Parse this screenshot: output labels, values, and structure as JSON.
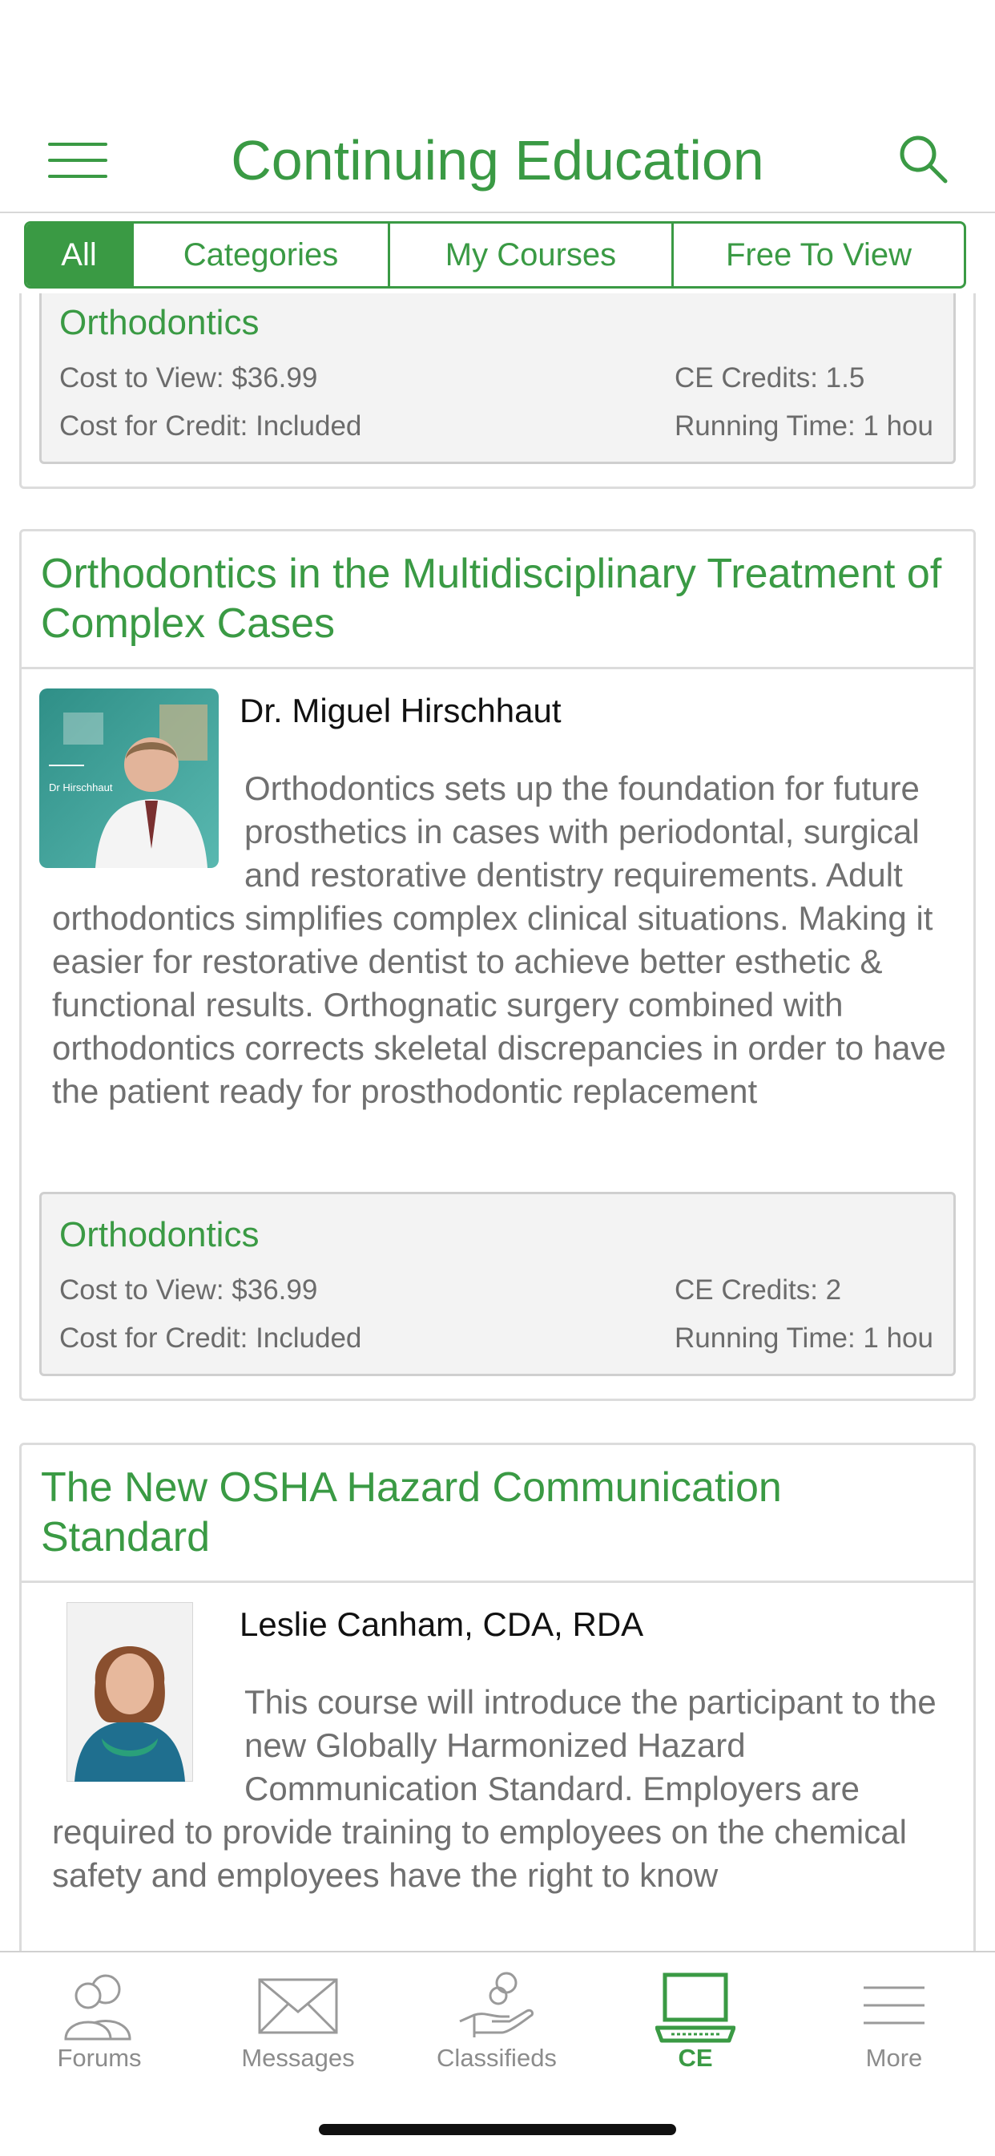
{
  "header": {
    "title": "Continuing Education"
  },
  "tabs": [
    {
      "label": "All",
      "active": true
    },
    {
      "label": "Categories",
      "active": false
    },
    {
      "label": "My Courses",
      "active": false
    },
    {
      "label": "Free To View",
      "active": false
    }
  ],
  "courses": [
    {
      "info": {
        "category": "Orthodontics",
        "cost_to_view": "Cost to View: $36.99",
        "cost_for_credit": "Cost for Credit: Included",
        "ce_credits": "CE Credits: 1.5",
        "running_time": "Running Time: 1 hou"
      }
    },
    {
      "title": "Orthodontics in the Multidisciplinary Treatment of Complex Cases",
      "presenter": "Dr. Miguel Hirschhaut",
      "photo_logo_text": "Dr Hirschhaut",
      "description": "Orthodontics sets up the foundation for future prosthetics in cases with periodontal, surgical and restorative dentistry requirements. Adult orthodontics simplifies complex clinical situations. Making it easier for restorative dentist to achieve better esthetic & functional results. Orthognatic surgery combined with orthodontics corrects skeletal discrepancies in order to have the patient ready for prosthodontic replacement",
      "info": {
        "category": "Orthodontics",
        "cost_to_view": "Cost to View: $36.99",
        "cost_for_credit": "Cost for Credit: Included",
        "ce_credits": "CE Credits: 2",
        "running_time": "Running Time: 1 hou"
      }
    },
    {
      "title": "The New OSHA Hazard Communication Standard",
      "presenter": "Leslie Canham, CDA, RDA",
      "description": "This course will introduce the participant to the new Globally Harmonized Hazard Communication Standard. Employers are required to provide training to employees on the chemical safety and employees have the right to know"
    }
  ],
  "tab_bar": [
    {
      "label": "Forums",
      "icon": "forums-icon",
      "active": false
    },
    {
      "label": "Messages",
      "icon": "messages-icon",
      "active": false
    },
    {
      "label": "Classifieds",
      "icon": "classifieds-icon",
      "active": false
    },
    {
      "label": "CE",
      "icon": "ce-laptop-icon",
      "active": true
    },
    {
      "label": "More",
      "icon": "more-icon",
      "active": false
    }
  ],
  "colors": {
    "accent": "#3a9a44",
    "muted_text": "#707070",
    "border": "#dcdcdc",
    "info_bg": "#f3f3f3"
  }
}
